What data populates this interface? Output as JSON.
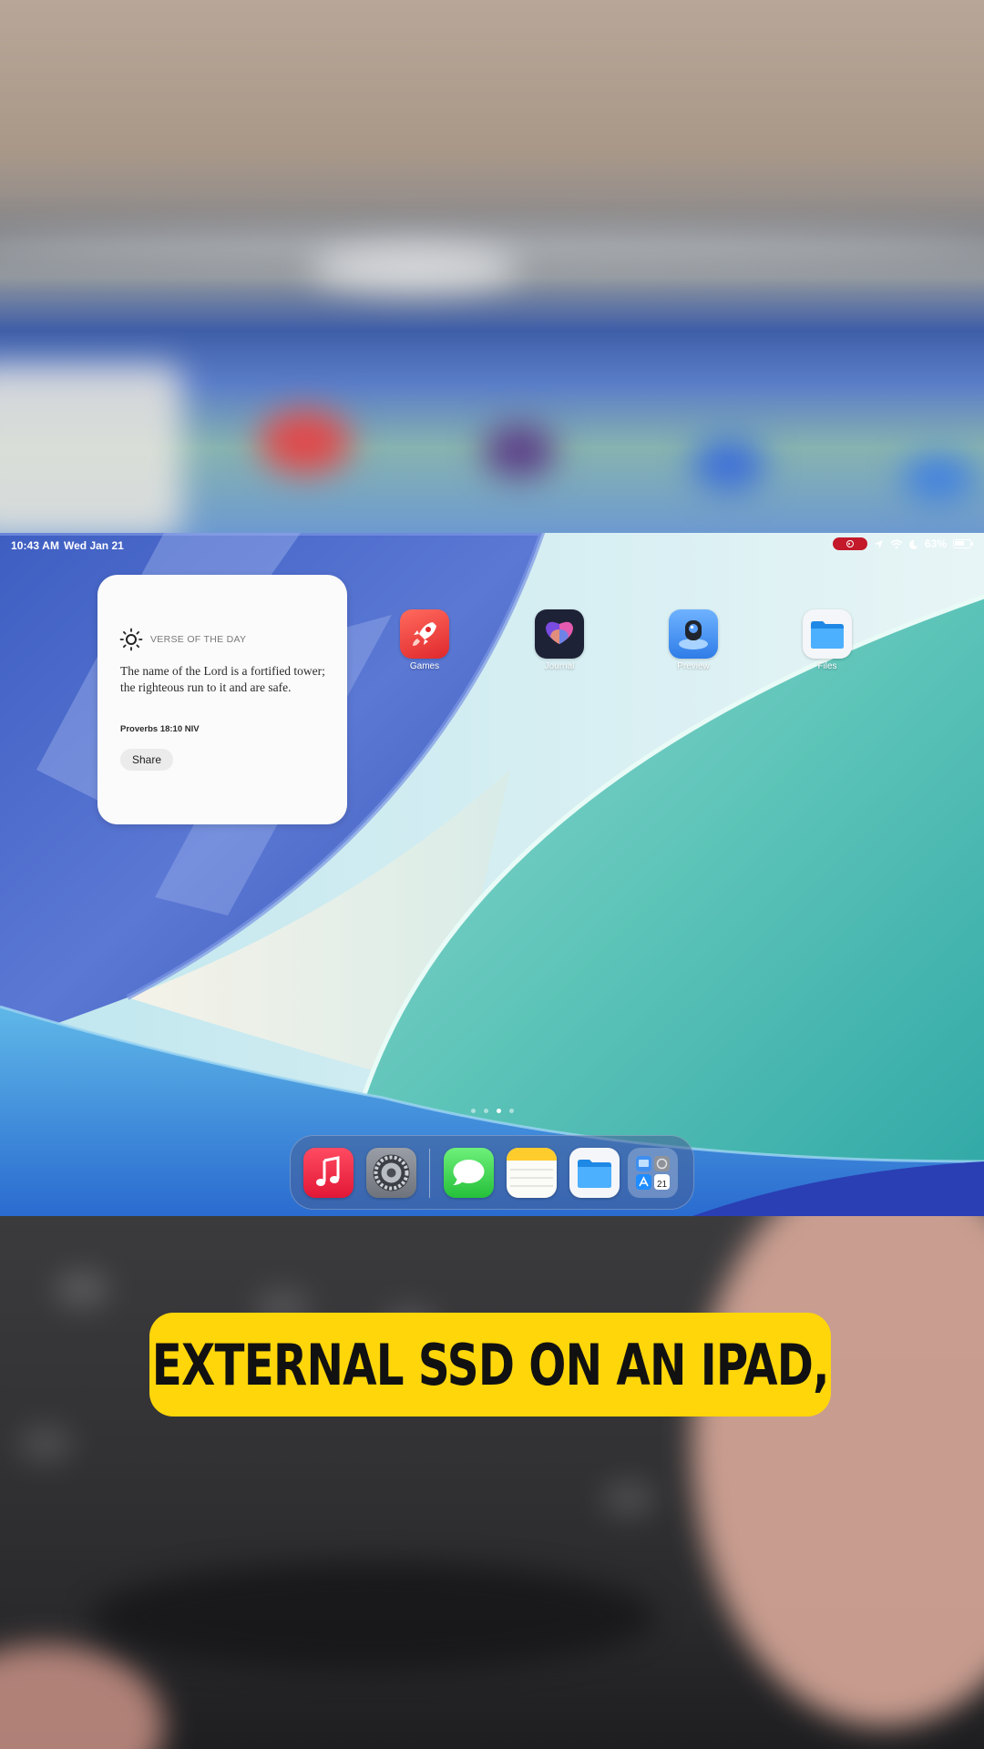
{
  "status_bar": {
    "time": "10:43 AM",
    "date": "Wed Jan 21",
    "battery": "63%"
  },
  "widget": {
    "title": "VERSE OF THE DAY",
    "verse": "The name of the Lord is a fortified tower; the righteous run to it and are safe.",
    "reference": "Proverbs 18:10 NIV",
    "share_label": "Share",
    "icon": "sun-icon"
  },
  "home_apps": [
    {
      "label": "Games",
      "icon": "games-rocket-icon"
    },
    {
      "label": "Journal",
      "icon": "journal-butterfly-icon"
    },
    {
      "label": "Preview",
      "icon": "preview-loupe-icon"
    },
    {
      "label": "Files",
      "icon": "files-folder-icon"
    }
  ],
  "page_indicator": {
    "count": 4,
    "active": 3
  },
  "dock": [
    {
      "name": "Music",
      "icon": "music-note-icon"
    },
    {
      "name": "Settings",
      "icon": "gear-icon"
    },
    {
      "name": "Messages",
      "icon": "speech-bubble-icon"
    },
    {
      "name": "Notes",
      "icon": "notepad-icon"
    },
    {
      "name": "Files",
      "icon": "folder-icon"
    },
    {
      "name": "App Library",
      "icon": "app-library-icon",
      "calendar_day": "21"
    }
  ],
  "caption": {
    "text": "EXTERNAL SSD ON AN IPAD,"
  },
  "colors": {
    "caption_bg": "#ffd60a",
    "record_pill": "#c3192b"
  }
}
